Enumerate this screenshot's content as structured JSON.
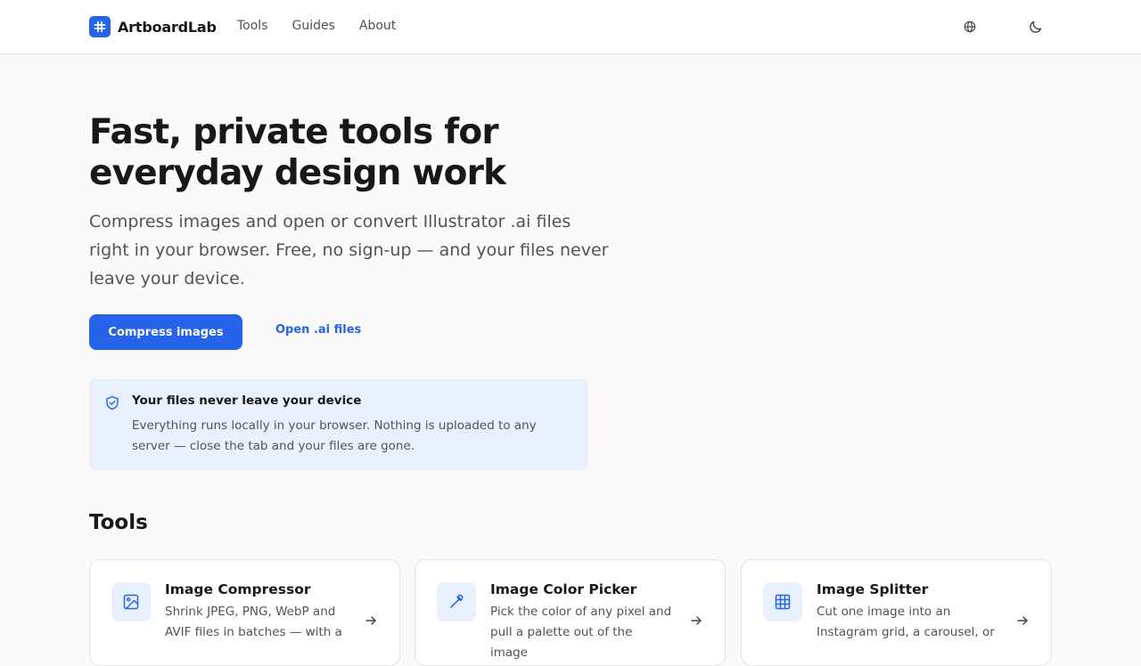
{
  "header": {
    "brand": "ArtboardLab",
    "nav": [
      "Tools",
      "Guides",
      "About"
    ]
  },
  "hero": {
    "title": "Fast, private tools for everyday design work",
    "subtitle": "Compress images and open or convert Illustrator .ai files right in your browser. Free, no sign-up — and your files never leave your device.",
    "primary_cta": "Compress images",
    "secondary_cta": "Open .ai files"
  },
  "privacy": {
    "title": "Your files never leave your device",
    "body": "Everything runs locally in your browser. Nothing is uploaded to any server — close the tab and your files are gone."
  },
  "tools": {
    "heading": "Tools",
    "cards": [
      {
        "title": "Image Compressor",
        "desc": "Shrink JPEG, PNG, WebP and AVIF files in batches — with a",
        "icon": "image-icon"
      },
      {
        "title": "Image Color Picker",
        "desc": "Pick the color of any pixel and pull a palette out of the image",
        "icon": "eyedropper-icon"
      },
      {
        "title": "Image Splitter",
        "desc": "Cut one image into an Instagram grid, a carousel, or",
        "icon": "grid-icon"
      }
    ]
  },
  "colors": {
    "accent": "#2563eb",
    "accent_soft": "#eaf1fe",
    "text": "#18181b",
    "muted": "#52525b",
    "border": "#e4e4e7"
  }
}
